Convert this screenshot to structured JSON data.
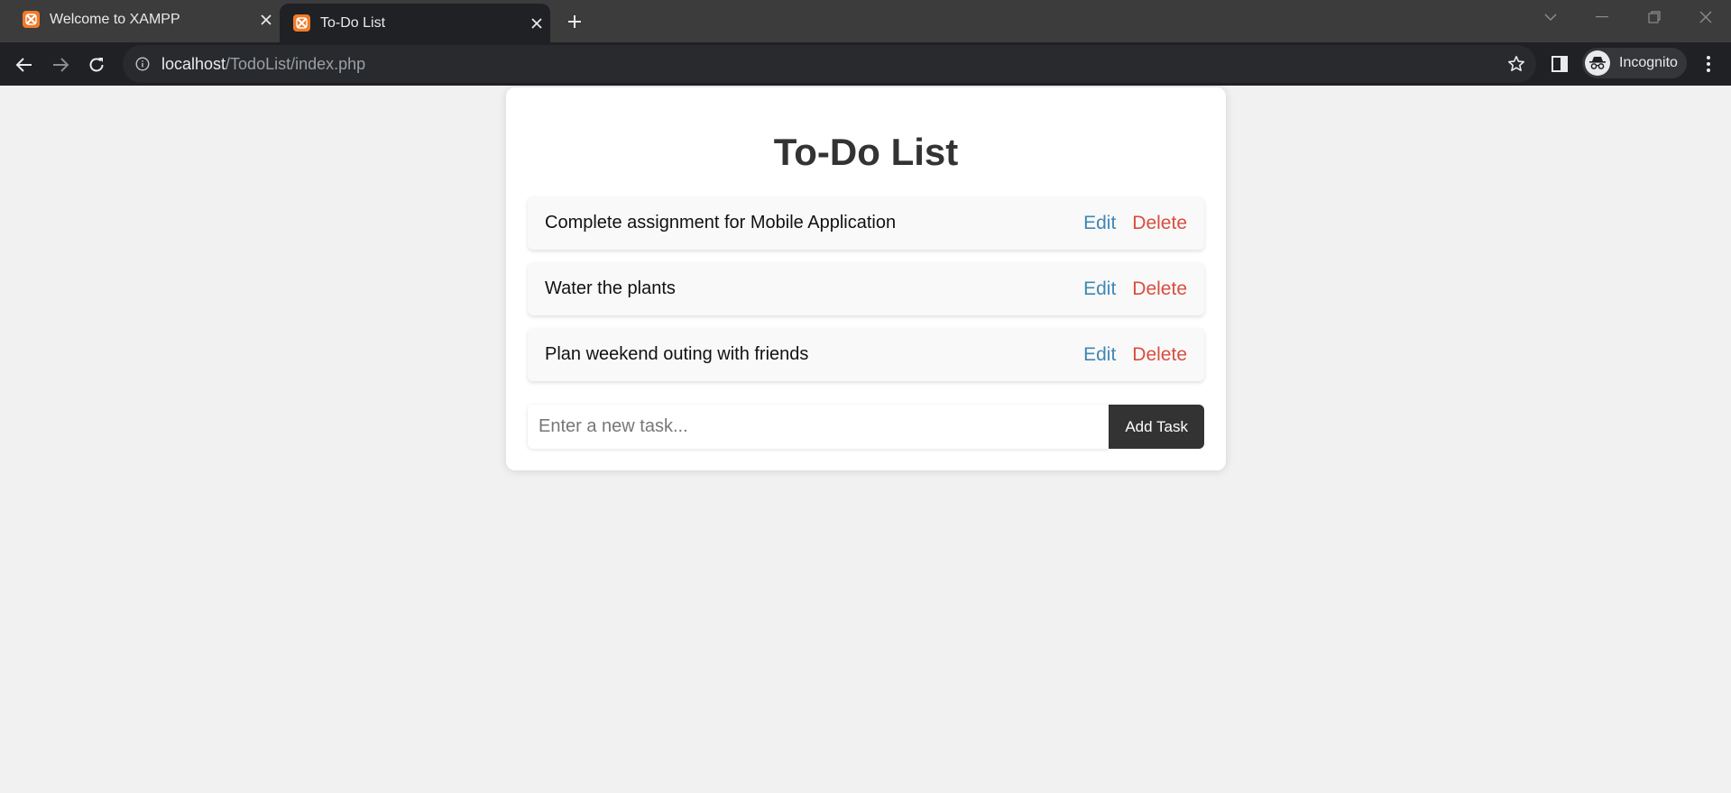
{
  "browser": {
    "tabs": [
      {
        "title": "Welcome to XAMPP"
      },
      {
        "title": "To-Do List"
      }
    ],
    "url_host": "localhost",
    "url_path": "/TodoList/index.php",
    "profile_label": "Incognito"
  },
  "page": {
    "title": "To-Do List",
    "tasks": [
      {
        "text": "Complete assignment for Mobile Application",
        "edit": "Edit",
        "delete": "Delete"
      },
      {
        "text": "Water the plants",
        "edit": "Edit",
        "delete": "Delete"
      },
      {
        "text": "Plan weekend outing with friends",
        "edit": "Edit",
        "delete": "Delete"
      }
    ],
    "new_task_placeholder": "Enter a new task...",
    "add_button": "Add Task"
  },
  "colors": {
    "edit_link": "#3f87b3",
    "delete_link": "#d94d3f",
    "add_button_bg": "#333333",
    "tab_favicon": "#f27a28"
  },
  "icons": {
    "tab_favicon": "xampp-icon",
    "tab_close": "close-icon",
    "new_tab": "plus-icon",
    "back": "arrow-left-icon",
    "forward": "arrow-right-icon",
    "reload": "reload-icon",
    "site_info": "info-icon",
    "bookmark": "star-icon",
    "side_panel": "side-panel-icon",
    "incognito": "incognito-icon",
    "menu": "kebab-menu-icon"
  }
}
